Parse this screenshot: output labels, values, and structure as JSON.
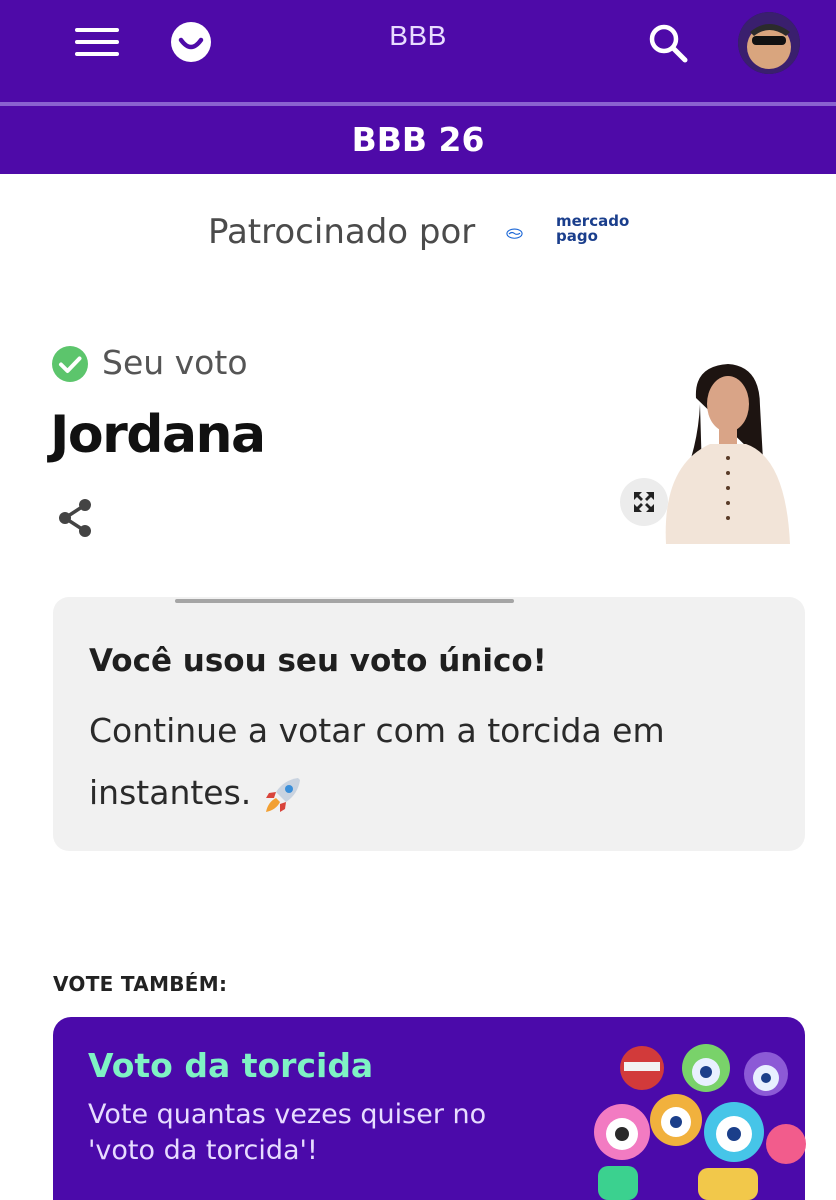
{
  "header": {
    "title": "BBB",
    "section": "BBB 26"
  },
  "sponsor": {
    "label": "Patrocinado por",
    "brand_line1": "mercado",
    "brand_line2": "pago"
  },
  "vote": {
    "status": "Seu voto",
    "candidate": "Jordana"
  },
  "card": {
    "title": "Você usou seu voto único!",
    "body": "Continue a votar com a torcida em instantes."
  },
  "also": {
    "label": "VOTE TAMBÉM:",
    "banner_title": "Voto da torcida",
    "banner_text": "Vote quantas vezes quiser no 'voto da torcida'!"
  },
  "colors": {
    "header_bg": "#4e0aa8",
    "banner_title": "#7ff2c4",
    "check_green": "#5cc56c"
  },
  "icons": [
    "menu-icon",
    "logo-icon",
    "search-icon",
    "avatar",
    "check-icon",
    "share-icon",
    "expand-icon",
    "rocket-icon"
  ]
}
